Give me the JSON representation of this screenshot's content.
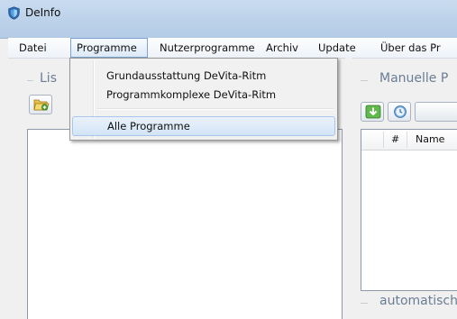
{
  "window": {
    "title": "DeInfo"
  },
  "menubar": {
    "items": [
      "Datei",
      "Programme",
      "Nutzerprogramme",
      "Archiv",
      "Update",
      "Über das Pr"
    ],
    "open_index": 1
  },
  "dropdown": {
    "items": [
      "Grundausstattung DeVita-Ritm",
      "Programmkomplexe DeVita-Ritm",
      "Alle Programme"
    ],
    "hover_index": 2
  },
  "left_panel": {
    "title": "Lis"
  },
  "right_panel": {
    "title": "Manuelle P",
    "grid_columns": [
      "#",
      "Name"
    ]
  },
  "bottom_panel": {
    "title": "automatisch"
  },
  "colors": {
    "titlebar": "#bcd2ea",
    "menu_open_border": "#7da2ce",
    "hover_border": "#a8c8eb",
    "group_title": "#6a7d94"
  },
  "icons": {
    "app": "shield-icon",
    "open": "folder-open-icon",
    "download": "download-arrow-icon",
    "clock": "clock-icon"
  }
}
